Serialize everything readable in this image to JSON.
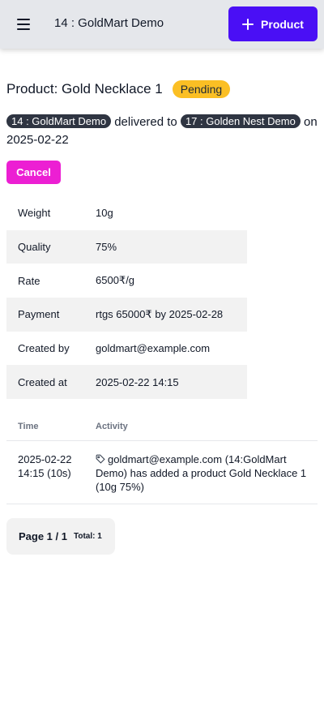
{
  "header": {
    "org_title": "14 : GoldMart Demo",
    "add_button_label": "Product"
  },
  "product": {
    "title": "Product: Gold Necklace 1",
    "status": "Pending",
    "from_chip": "14 : GoldMart Demo",
    "delivered_to_text": "delivered to",
    "to_chip": "17 : Golden Nest Demo",
    "date_text": "on 2025-02-22",
    "cancel_label": "Cancel"
  },
  "details": [
    {
      "key": "Weight",
      "value": "10g"
    },
    {
      "key": "Quality",
      "value": "75%"
    },
    {
      "key": "Rate",
      "value": "6500₹/g"
    },
    {
      "key": "Payment",
      "value": "rtgs 65000₹ by 2025-02-28"
    },
    {
      "key": "Created by",
      "value": "goldmart@example.com"
    },
    {
      "key": "Created at",
      "value": "2025-02-22 14:15"
    }
  ],
  "activity": {
    "headers": {
      "time": "Time",
      "activity": "Activity"
    },
    "rows": [
      {
        "time": "2025-02-22 14:15 (10s)",
        "icon": "tag-icon",
        "text": "goldmart@example.com (14:GoldMart Demo) has added a product Gold Necklace 1 (10g 75%)"
      }
    ]
  },
  "pagination": {
    "page_label": "Page 1 / 1",
    "total_label": "Total: 1"
  },
  "colors": {
    "primary": "#4a0ff5",
    "cancel": "#ec1fd3",
    "pending": "#fbbf24",
    "chip": "#2f3542"
  }
}
